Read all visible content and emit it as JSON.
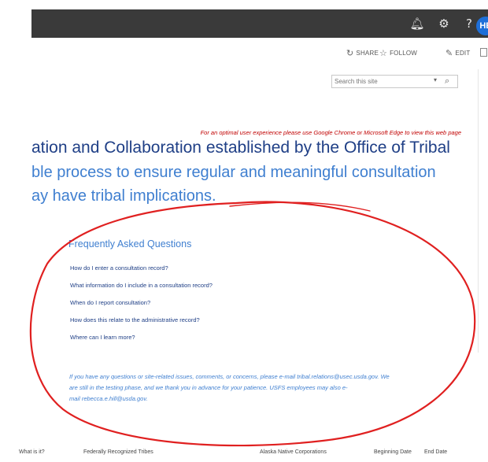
{
  "suite_bar": {
    "bell_icon": "bell-icon",
    "gear_icon": "gear-icon",
    "help_icon": "?",
    "avatar_initials": "HE"
  },
  "actions": {
    "share": "SHARE",
    "follow": "FOLLOW",
    "edit": "EDIT"
  },
  "search": {
    "placeholder": "Search this site"
  },
  "browser_warning": "For an optimal user experience please use Google Chrome or Microsoft Edge to view this web page",
  "hero": {
    "line1": "ation and Collaboration established by the Office of Tribal",
    "line2": "ble process to ensure regular and meaningful consultation",
    "line3": "ay have tribal implications."
  },
  "faq": {
    "title": "Frequently Asked Questions",
    "items": [
      "How do I enter a consultation record?",
      "What information do I include in a consultation record?",
      "When do I report consultation?",
      "How does this relate to the administrative record?",
      "Where can I learn more?"
    ]
  },
  "contact": {
    "line1": "If you have any questions or site-related issues, comments, or concerns, please e-mail tribal.relations@usec.usda.gov. We",
    "line2": "are still in the testing phase, and we thank you in advance for your patience. USFS employees may also e-",
    "line3": "mail rebecca.e.hill@usda.gov."
  },
  "bottom_row": {
    "col1": "What is it?",
    "col2": "Federally Recognized Tribes",
    "col3": "Alaska Native Corporations",
    "col4": "Beginning Date",
    "col5": "End Date"
  },
  "colors": {
    "suite_bar": "#3a3a3a",
    "heading_dark": "#1f3f86",
    "heading_light": "#3f7fd0",
    "warning_red": "#c00000",
    "annotation_red": "#e02020"
  }
}
